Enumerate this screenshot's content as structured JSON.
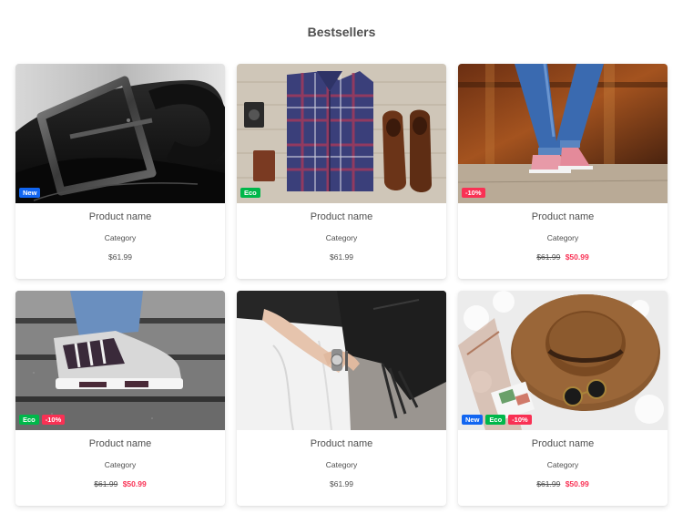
{
  "section": {
    "title": "Bestsellers"
  },
  "colors": {
    "new": "#1266f1",
    "eco": "#00b74a",
    "sale": "#f93154",
    "text": "#4f4f4f"
  },
  "products": [
    {
      "image": "belt",
      "badges": [
        "New"
      ],
      "name": "Product name",
      "category": "Category",
      "price": "$61.99",
      "old_price": "",
      "sale_price": ""
    },
    {
      "image": "shirt-flatlay",
      "badges": [
        "Eco"
      ],
      "name": "Product name",
      "category": "Category",
      "price": "$61.99",
      "old_price": "",
      "sale_price": ""
    },
    {
      "image": "jeans-sneakers",
      "badges": [
        "-10%"
      ],
      "name": "Product name",
      "category": "Category",
      "price": "",
      "old_price": "$61.99",
      "sale_price": "$50.99"
    },
    {
      "image": "sneakers-stairs",
      "badges": [
        "Eco",
        "-10%"
      ],
      "name": "Product name",
      "category": "Category",
      "price": "",
      "old_price": "$61.99",
      "sale_price": "$50.99"
    },
    {
      "image": "watch-jacket",
      "badges": [],
      "name": "Product name",
      "category": "Category",
      "price": "$61.99",
      "old_price": "",
      "sale_price": ""
    },
    {
      "image": "hat-sunglasses",
      "badges": [
        "New",
        "Eco",
        "-10%"
      ],
      "name": "Product name",
      "category": "Category",
      "price": "",
      "old_price": "$61.99",
      "sale_price": "$50.99"
    }
  ]
}
